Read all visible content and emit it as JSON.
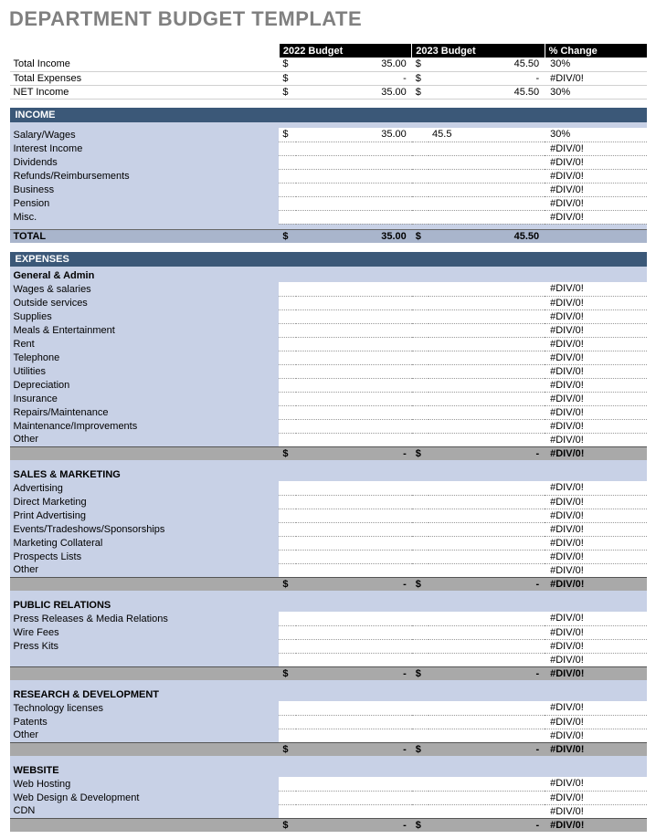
{
  "title": "DEPARTMENT BUDGET TEMPLATE",
  "headers": {
    "b1": "2022 Budget",
    "b2": "2023 Budget",
    "chg": "% Change"
  },
  "currency": "$",
  "dash": "-",
  "div0": "#DIV/0!",
  "summary": [
    {
      "label": "Total Income",
      "b1": "35.00",
      "b2": "45.50",
      "chg": "30%"
    },
    {
      "label": "Total Expenses",
      "b1": "-",
      "b2": "-",
      "chg": "#DIV/0!"
    },
    {
      "label": "NET Income",
      "b1": "35.00",
      "b2": "45.50",
      "chg": "30%"
    }
  ],
  "income": {
    "title": "INCOME",
    "rows": [
      {
        "label": "Salary/Wages",
        "b1": "35.00",
        "b2": "45.5",
        "chg": "30%"
      },
      {
        "label": "Interest Income",
        "b1": "",
        "b2": "",
        "chg": "#DIV/0!"
      },
      {
        "label": "Dividends",
        "b1": "",
        "b2": "",
        "chg": "#DIV/0!"
      },
      {
        "label": "Refunds/Reimbursements",
        "b1": "",
        "b2": "",
        "chg": "#DIV/0!"
      },
      {
        "label": "Business",
        "b1": "",
        "b2": "",
        "chg": "#DIV/0!"
      },
      {
        "label": "Pension",
        "b1": "",
        "b2": "",
        "chg": "#DIV/0!"
      },
      {
        "label": "Misc.",
        "b1": "",
        "b2": "",
        "chg": "#DIV/0!"
      }
    ],
    "total": {
      "label": "TOTAL",
      "b1": "35.00",
      "b2": "45.50",
      "chg": ""
    }
  },
  "expenses": {
    "title": "EXPENSES",
    "groups": [
      {
        "name": "General & Admin",
        "rows": [
          {
            "label": "Wages & salaries"
          },
          {
            "label": "Outside services"
          },
          {
            "label": "Supplies"
          },
          {
            "label": "Meals & Entertainment"
          },
          {
            "label": "Rent"
          },
          {
            "label": "Telephone"
          },
          {
            "label": "Utilities"
          },
          {
            "label": "Depreciation"
          },
          {
            "label": "Insurance"
          },
          {
            "label": "Repairs/Maintenance"
          },
          {
            "label": "Maintenance/Improvements"
          },
          {
            "label": "Other"
          }
        ]
      },
      {
        "name": "SALES & MARKETING",
        "rows": [
          {
            "label": "Advertising"
          },
          {
            "label": "Direct Marketing"
          },
          {
            "label": "Print Advertising"
          },
          {
            "label": "Events/Tradeshows/Sponsorships"
          },
          {
            "label": "Marketing Collateral"
          },
          {
            "label": "Prospects Lists"
          },
          {
            "label": "Other"
          }
        ]
      },
      {
        "name": "PUBLIC RELATIONS",
        "rows": [
          {
            "label": "Press Releases & Media Relations"
          },
          {
            "label": "Wire Fees"
          },
          {
            "label": "Press Kits"
          },
          {
            "label": ""
          }
        ]
      },
      {
        "name": "RESEARCH & DEVELOPMENT",
        "rows": [
          {
            "label": "Technology licenses"
          },
          {
            "label": "Patents"
          },
          {
            "label": "Other"
          }
        ]
      },
      {
        "name": "WEBSITE",
        "rows": [
          {
            "label": "Web Hosting"
          },
          {
            "label": "Web Design & Development"
          },
          {
            "label": "CDN"
          }
        ]
      }
    ]
  }
}
